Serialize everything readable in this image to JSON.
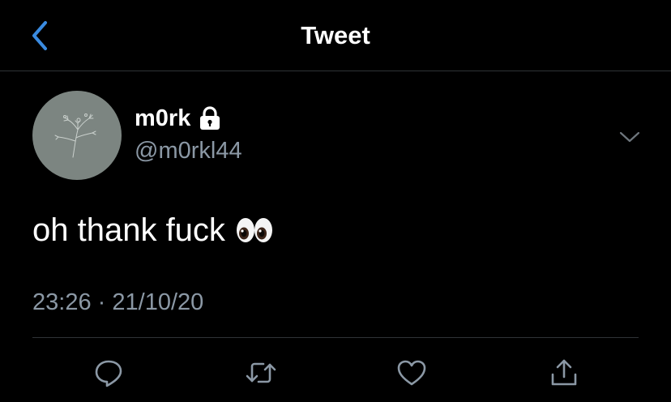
{
  "header": {
    "title": "Tweet",
    "back_icon": "chevron-left-icon"
  },
  "tweet": {
    "author": {
      "display_name": "m0rk",
      "handle": "@m0rkl44",
      "protected_icon": "lock-icon",
      "avatar_icon": "flower-sketch-avatar"
    },
    "text": "oh thank fuck",
    "emoji": "eyes-emoji",
    "time": "23:26",
    "separator": "·",
    "date": "21/10/20"
  },
  "actions": [
    {
      "name": "reply",
      "icon": "comment-icon"
    },
    {
      "name": "retweet",
      "icon": "retweet-icon"
    },
    {
      "name": "like",
      "icon": "heart-icon"
    },
    {
      "name": "share",
      "icon": "share-icon"
    }
  ],
  "colors": {
    "background": "#000000",
    "accent": "#1d9bf0",
    "secondary_text": "#8b98a5",
    "divider": "#2f3336",
    "avatar_bg": "#7c8581"
  }
}
